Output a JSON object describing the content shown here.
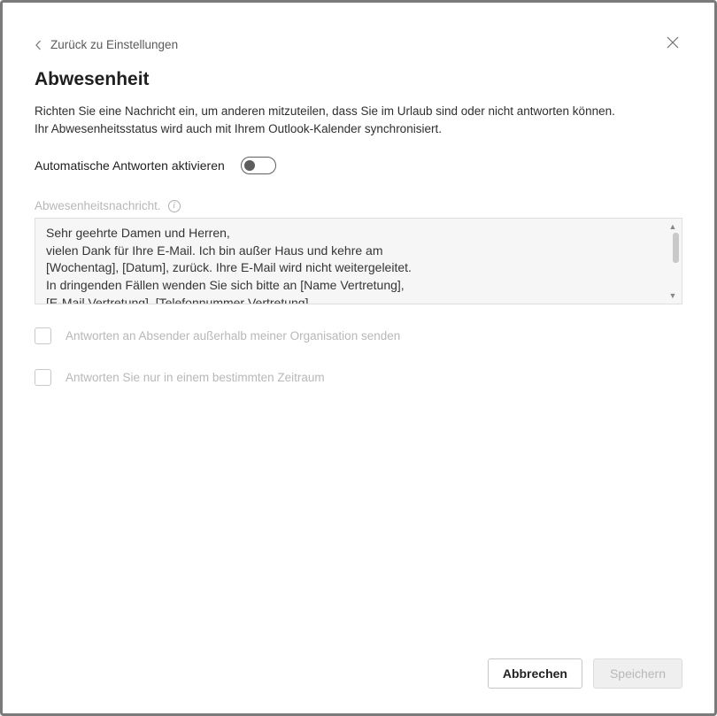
{
  "back_label": "Zurück zu Einstellungen",
  "title": "Abwesenheit",
  "description_line1": "Richten Sie eine Nachricht ein, um anderen mitzuteilen, dass Sie im Urlaub sind oder nicht antworten können.",
  "description_line2": "Ihr Abwesenheitsstatus wird auch mit Ihrem Outlook-Kalender synchronisiert.",
  "toggle_label": "Automatische Antworten aktivieren",
  "toggle_on": false,
  "message_label": "Abwesenheitsnachricht.",
  "message_body": "Sehr geehrte Damen und Herren,\nvielen Dank für Ihre E-Mail. Ich bin außer Haus und kehre am\n[Wochentag], [Datum], zurück. Ihre E-Mail wird nicht weitergeleitet.\nIn dringenden Fällen wenden Sie sich bitte an [Name Vertretung],\n[E-Mail Vertretung], [Telefonnummer Vertretung].",
  "checkbox_external_label": "Antworten an Absender außerhalb meiner Organisation senden",
  "checkbox_external_checked": false,
  "checkbox_period_label": "Antworten Sie nur in einem bestimmten Zeitraum",
  "checkbox_period_checked": false,
  "cancel_label": "Abbrechen",
  "save_label": "Speichern",
  "save_enabled": false
}
